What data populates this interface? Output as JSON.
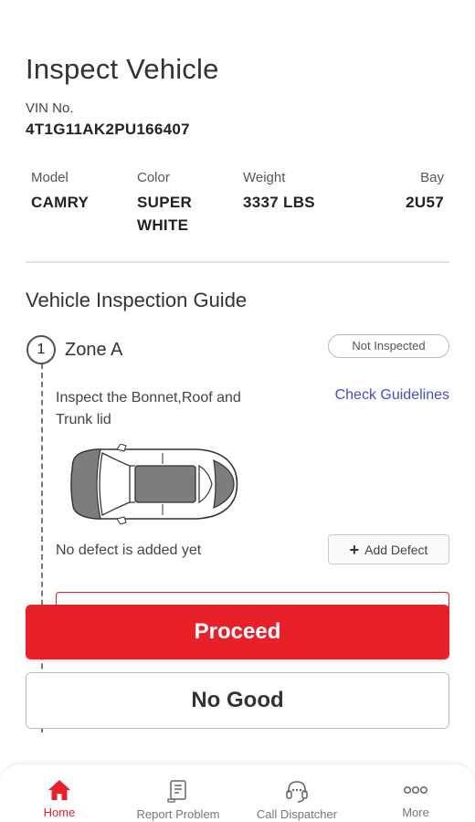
{
  "header": {
    "title": "Inspect Vehicle"
  },
  "vehicle": {
    "vin_label": "VIN No.",
    "vin_value": "4T1G11AK2PU166407",
    "specs": [
      {
        "label": "Model",
        "value": "CAMRY"
      },
      {
        "label": "Color",
        "value": "SUPER WHITE"
      },
      {
        "label": "Weight",
        "value": "3337 LBS"
      },
      {
        "label": "Bay",
        "value": "2U57"
      }
    ]
  },
  "guide": {
    "title": "Vehicle Inspection Guide",
    "zone": {
      "number": "1",
      "name": "Zone A",
      "status": "Not Inspected",
      "instruction": "Inspect the Bonnet,Roof and Trunk lid",
      "guidelines_link": "Check Guidelines",
      "no_defect_text": "No defect is added yet",
      "add_defect_label": "Add Defect",
      "diagram_icon": "car-top-view-icon"
    }
  },
  "actions": {
    "proceed": "Proceed",
    "no_good": "No Good"
  },
  "colors": {
    "accent": "#e8202a",
    "link": "#4a4ad0"
  },
  "bottom_nav": [
    {
      "label": "Home",
      "icon": "home-icon",
      "active": true
    },
    {
      "label": "Report Problem",
      "icon": "report-problem-icon",
      "active": false
    },
    {
      "label": "Call Dispatcher",
      "icon": "headset-icon",
      "active": false
    },
    {
      "label": "More",
      "icon": "more-icon",
      "active": false
    }
  ]
}
